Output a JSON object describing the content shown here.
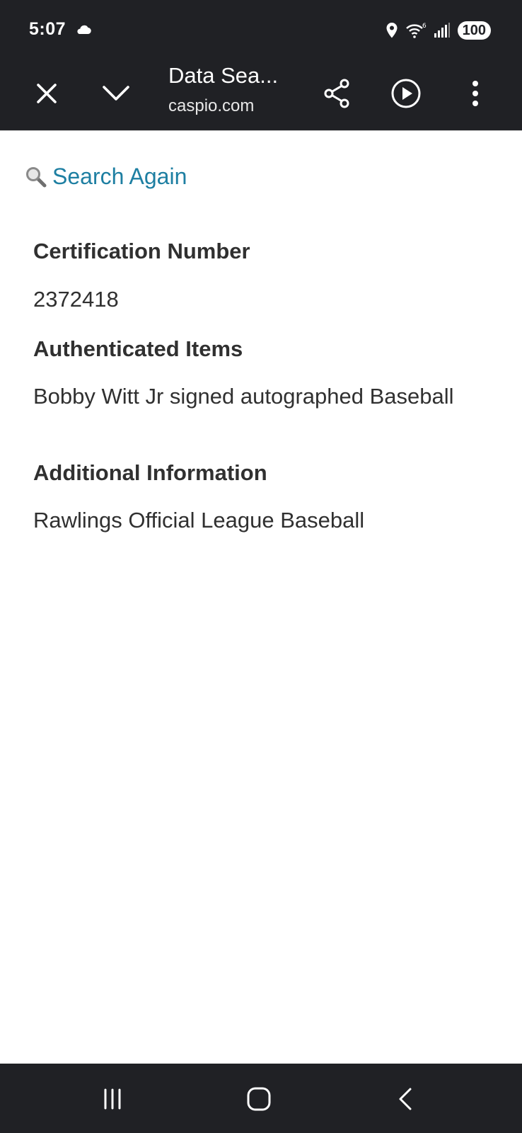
{
  "status_bar": {
    "time": "5:07",
    "battery": "100"
  },
  "toolbar": {
    "title": "Data Sea...",
    "url": "caspio.com"
  },
  "page": {
    "search_again_label": "Search Again",
    "fields": [
      {
        "label": "Certification Number",
        "value": "2372418"
      },
      {
        "label": "Authenticated Items",
        "value": "Bobby Witt Jr signed autographed Baseball"
      },
      {
        "label": "Additional Information",
        "value": "Rawlings Official League Baseball"
      }
    ]
  },
  "colors": {
    "bar_background": "#202125",
    "link": "#1e7fa2",
    "text": "#303030"
  }
}
